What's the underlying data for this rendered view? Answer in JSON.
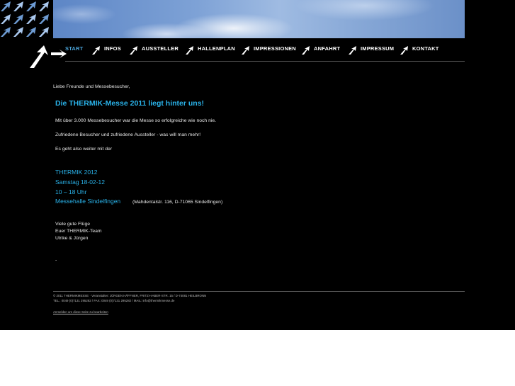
{
  "brand": {
    "accent": "#2ab3ea",
    "nav_active": "#4aa3d8",
    "background": "#000000",
    "logo_tile_colors": [
      "#6d9bd3",
      "#aac8ee"
    ]
  },
  "nav": {
    "items": [
      {
        "label": "START",
        "active": true
      },
      {
        "label": "INFOS"
      },
      {
        "label": "AUSSTELLER"
      },
      {
        "label": "HALLENPLAN"
      },
      {
        "label": "IMPRESSIONEN"
      },
      {
        "label": "ANFAHRT"
      },
      {
        "label": "IMPRESSUM"
      },
      {
        "label": "KONTAKT"
      }
    ]
  },
  "content": {
    "greeting": "Liebe Freunde und Messebesucher,",
    "headline": "Die THERMIK-Messe 2011 liegt hinter uns!",
    "p1": "Mit über 3.000 Messebesucher war die Messe so erfolgreiche wie noch nie.",
    "p2": "Zufriedene Besucher und zufriedene Aussteller - was will man mehr!",
    "p3": "Es geht also weiter mit der",
    "event": {
      "name": "THERMIK 2012",
      "date": "Samstag 18-02-12",
      "time": "10 – 18 Uhr",
      "venue": "Messehalle Sindelfingen",
      "address": "(Mahdentalstr. 116, D-71065 Sindelfingen)"
    },
    "closing": {
      "line1": "Viele gute Flüge",
      "line2": "Euer THERMIK-Team",
      "line3": "Ulrike & Jürgen"
    },
    "dash": "-"
  },
  "footer": {
    "line1": "© 2011 THERMIKMESSE · Veranstalter: JÜRGEN HÄFFNER, FRITZ-HABER-STR. 15 / D-74081 HEILBRONN",
    "line2": "TEL.: 0049 (0)7131 295282 / FAX: 0049 (0)7131 295282 / MAIL: info@thermikmesse.de",
    "link": "Anmelden um diese Seite zu bearbeiten"
  }
}
